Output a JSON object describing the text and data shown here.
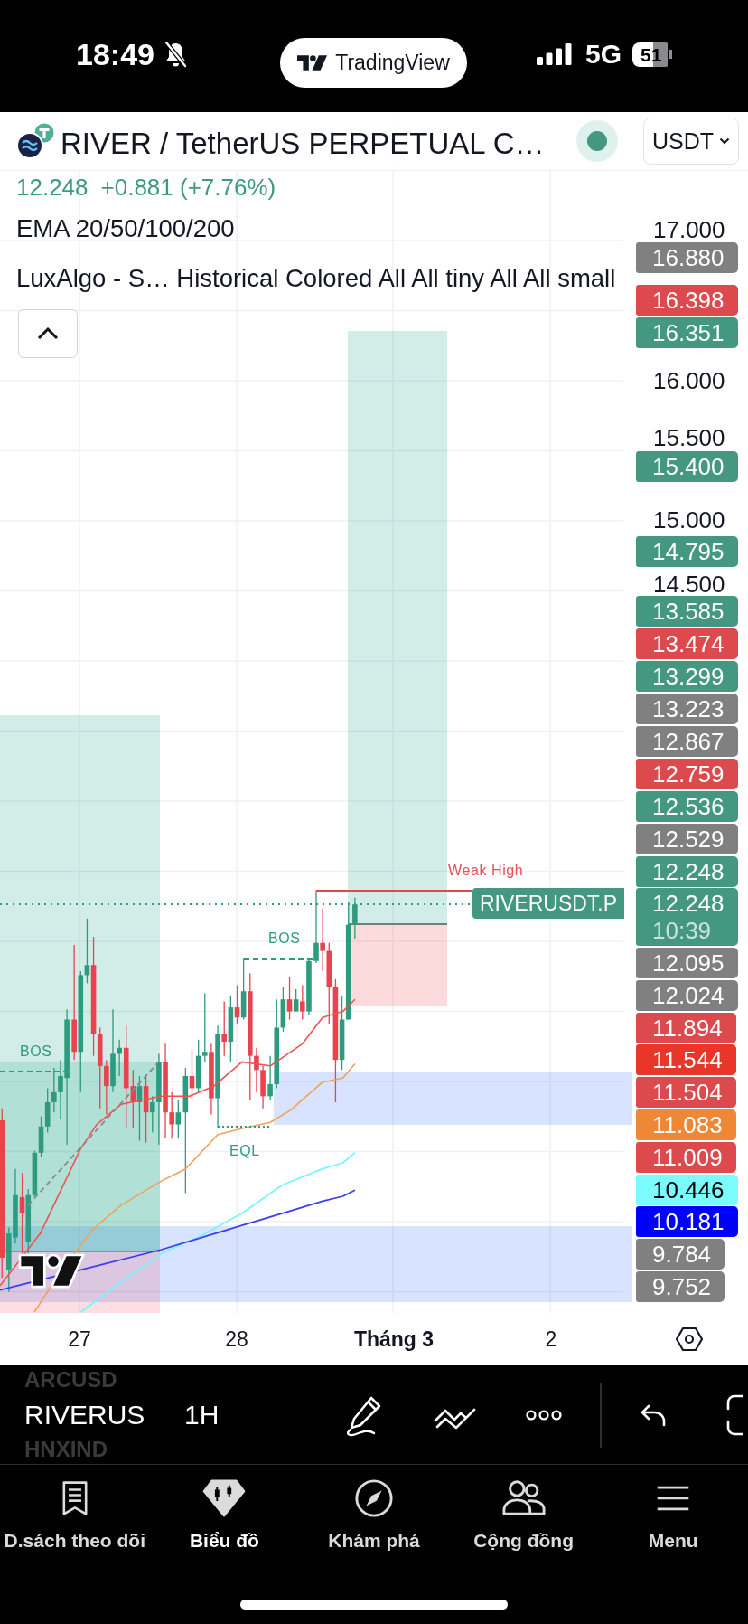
{
  "status_bar": {
    "time": "18:49",
    "app": "TradingView",
    "network": "5G",
    "battery": "51"
  },
  "header": {
    "symbol": "RIVER / TetherUS PERPETUAL C…",
    "currency": "USDT",
    "last_price": "12.248",
    "change": "+0.881 (+7.76%)"
  },
  "legend": {
    "expanded": true,
    "indicators": [
      "EMA 20/50/100/200",
      "LuxAlgo - S… Historical Colored All All tiny All All small"
    ]
  },
  "chart": {
    "price_ticks": [
      "17.000",
      "16.000",
      "15.500",
      "15.000",
      "14.500"
    ],
    "price_labels": [
      {
        "text": "16.880",
        "color": "#808080"
      },
      {
        "text": "16.398",
        "color": "#dc4a4e"
      },
      {
        "text": "16.351",
        "color": "#449881"
      },
      {
        "text": "15.400",
        "color": "#449881"
      },
      {
        "text": "14.795",
        "color": "#449881"
      },
      {
        "text": "13.585",
        "color": "#449881"
      },
      {
        "text": "13.474",
        "color": "#dc4a4e"
      },
      {
        "text": "13.299",
        "color": "#449881"
      },
      {
        "text": "13.223",
        "color": "#808080"
      },
      {
        "text": "12.867",
        "color": "#808080"
      },
      {
        "text": "12.759",
        "color": "#dc4a4e"
      },
      {
        "text": "12.536",
        "color": "#449881"
      },
      {
        "text": "12.529",
        "color": "#808080"
      },
      {
        "text": "12.248",
        "color": "#449881"
      },
      {
        "text": "12.248",
        "countdown": "10:39",
        "color": "#449881"
      },
      {
        "text": "12.095",
        "color": "#808080"
      },
      {
        "text": "12.024",
        "color": "#808080"
      },
      {
        "text": "11.894",
        "color": "#dc4a4e"
      },
      {
        "text": "11.544",
        "color": "#e9362a"
      },
      {
        "text": "11.504",
        "color": "#dc4a4e"
      },
      {
        "text": "11.083",
        "color": "#ef8836"
      },
      {
        "text": "11.009",
        "color": "#dc4a4e"
      },
      {
        "text": "10.446",
        "color": "#7afcff"
      },
      {
        "text": "10.181",
        "color": "#0000ff"
      },
      {
        "text": "9.784",
        "color": "#808080"
      },
      {
        "text": "9.752",
        "color": "#808080"
      }
    ],
    "annotations": [
      {
        "kind": "weak_high",
        "text": "Weak High"
      },
      {
        "kind": "bos",
        "text": "BOS"
      },
      {
        "kind": "bos",
        "text": "BOS"
      },
      {
        "kind": "eql",
        "text": "EQL"
      }
    ],
    "symbol_label": "RIVERUSDT.P",
    "time_ticks": [
      {
        "text": "27",
        "kind": "day"
      },
      {
        "text": "28",
        "kind": "day"
      },
      {
        "text": "Tháng 3",
        "kind": "month"
      },
      {
        "text": "2",
        "kind": "day"
      }
    ]
  },
  "toolbar": {
    "symbols": [
      {
        "text": "ARCUSD",
        "selected": false
      },
      {
        "text": "RIVERUS",
        "selected": true
      },
      {
        "text": "HNXIND",
        "selected": false
      }
    ],
    "interval": "1H"
  },
  "tab_bar": [
    {
      "label": "D.sách theo dõi",
      "selected": false
    },
    {
      "label": "Biểu đồ",
      "selected": true
    },
    {
      "label": "Khám phá",
      "selected": false
    },
    {
      "label": "Cộng đồng",
      "selected": false
    },
    {
      "label": "Menu",
      "selected": false
    }
  ]
}
